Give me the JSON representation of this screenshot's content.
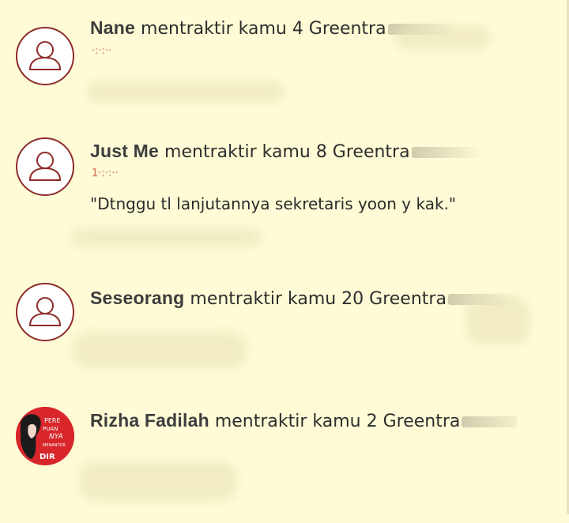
{
  "notifications": [
    {
      "name": "Nane",
      "action": " mentraktir kamu 4 Greentra",
      "time": "·:·:··",
      "message": "",
      "avatar": "default-avatar",
      "avatar_icon": "person-outline-icon"
    },
    {
      "name": "Just Me",
      "action": " mentraktir kamu 8 Greentra",
      "time": "1·:·:··",
      "message": "\"Dtnggu tl lanjutannya sekretaris yoon y kak.\"",
      "avatar": "default-avatar",
      "avatar_icon": "person-outline-icon"
    },
    {
      "name": "Seseorang",
      "action": " mentraktir kamu 20 Greentra",
      "time": "",
      "message": "",
      "avatar": "default-avatar",
      "avatar_icon": "person-outline-icon"
    },
    {
      "name": "Rizha Fadilah",
      "action": " mentraktir kamu 2 Greentra",
      "time": "",
      "message": "",
      "avatar": "photo-avatar",
      "avatar_icon": "profile-photo"
    }
  ],
  "colors": {
    "background": "#fefbd6",
    "avatar_border": "#8f2b2b",
    "time_text": "#c0392b",
    "photo_avatar_bg": "#d8262a"
  }
}
